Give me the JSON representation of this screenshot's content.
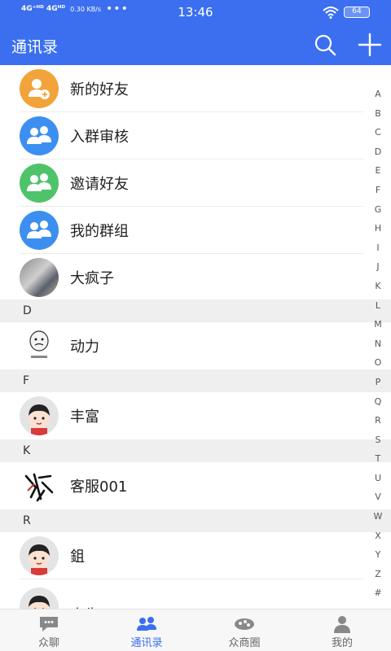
{
  "status_bar": {
    "network": "4G⁺ᴴᴰ 4Gᴴᴰ",
    "speed": "0.30 KB/s",
    "dots": "•••",
    "time": "13:46",
    "battery": "64"
  },
  "header": {
    "title": "通讯录"
  },
  "contacts": {
    "functions": [
      {
        "label": "新的好友",
        "icon": "add-friend-icon",
        "color": "#f2a33a"
      },
      {
        "label": "入群审核",
        "icon": "group-review-icon",
        "color": "#3c8ff0"
      },
      {
        "label": "邀请好友",
        "icon": "invite-friend-icon",
        "color": "#4fc36a"
      },
      {
        "label": "我的群组",
        "icon": "my-groups-icon",
        "color": "#3c8ff0"
      }
    ],
    "first_contact": "大疯子",
    "sections": [
      {
        "header": "D",
        "contact": "动力"
      },
      {
        "header": "F",
        "contact": "丰富"
      },
      {
        "header": "K",
        "contact": "客服001"
      },
      {
        "header": "R",
        "contact": "鉏"
      }
    ],
    "last_contact": "人生"
  },
  "index_letters": [
    "A",
    "B",
    "C",
    "D",
    "E",
    "F",
    "G",
    "H",
    "I",
    "J",
    "K",
    "L",
    "M",
    "N",
    "O",
    "P",
    "Q",
    "R",
    "S",
    "T",
    "U",
    "V",
    "W",
    "X",
    "Y",
    "Z",
    "#"
  ],
  "bottom_nav": {
    "tabs": [
      {
        "label": "众聊",
        "icon": "chat-icon",
        "active": false
      },
      {
        "label": "通讯录",
        "icon": "contacts-icon",
        "active": true
      },
      {
        "label": "众商圈",
        "icon": "circle-icon",
        "active": false
      },
      {
        "label": "我的",
        "icon": "profile-icon",
        "active": false
      }
    ]
  },
  "colors": {
    "primary": "#3b6ff0",
    "section_bg": "#efefef"
  }
}
